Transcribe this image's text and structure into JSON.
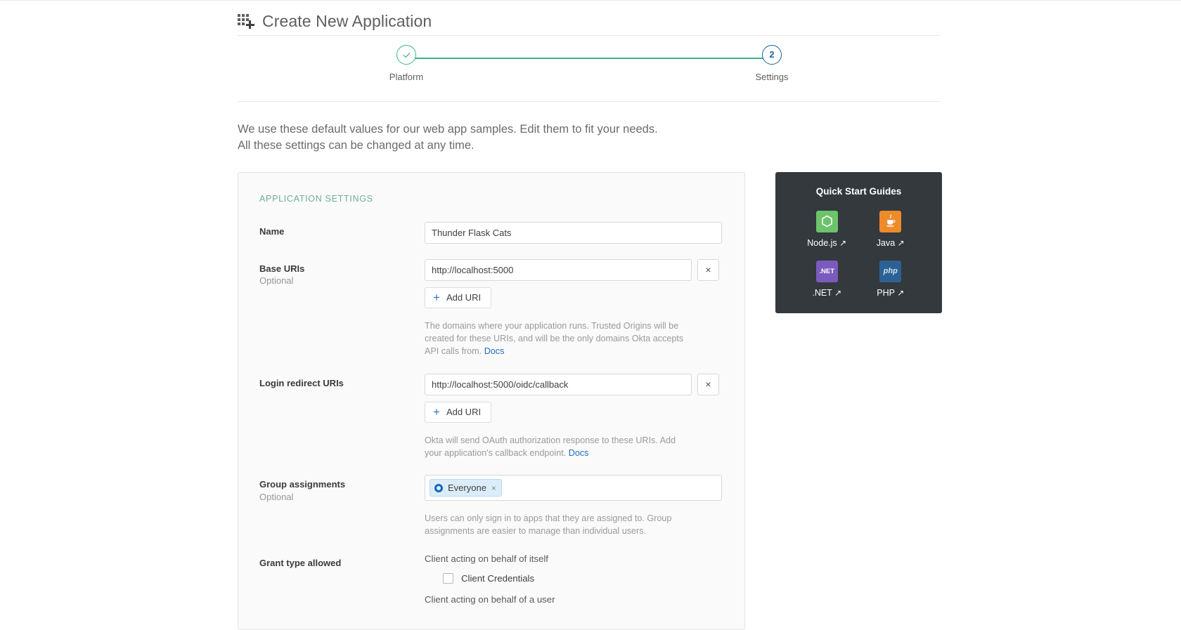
{
  "header": {
    "icon": "grid-plus-icon",
    "title": "Create New Application"
  },
  "stepper": {
    "step1": {
      "label": "Platform",
      "state": "completed",
      "icon": "check-icon"
    },
    "step2": {
      "label": "Settings",
      "number": "2",
      "state": "current"
    },
    "line_color": "#3db388",
    "current_color": "#1662a8"
  },
  "intro": {
    "line1": "We use these default values for our web app samples. Edit them to fit your needs.",
    "line2": "All these settings can be changed at any time."
  },
  "settings": {
    "section_title": "APPLICATION SETTINGS",
    "name": {
      "label": "Name",
      "value": "Thunder Flask Cats",
      "placeholder": ""
    },
    "base_uris": {
      "label": "Base URIs",
      "optional": "Optional",
      "value": "http://localhost:5000",
      "remove_label": "×",
      "add_label": "Add URI",
      "add_icon": "plus-icon",
      "help": "The domains where your application runs. Trusted Origins will be created for these URIs, and will be the only domains Okta accepts API calls from.",
      "docs_label": "Docs"
    },
    "login_redirect_uris": {
      "label": "Login redirect URIs",
      "value": "http://localhost:5000/oidc/callback",
      "remove_label": "×",
      "add_label": "Add URI",
      "add_icon": "plus-icon",
      "help": "Okta will send OAuth authorization response to these URIs. Add your application's callback endpoint.",
      "docs_label": "Docs"
    },
    "group_assignments": {
      "label": "Group assignments",
      "optional": "Optional",
      "chip_label": "Everyone",
      "chip_remove": "×",
      "help": "Users can only sign in to apps that they are assigned to. Group assignments are easier to manage than individual users."
    },
    "grant_type": {
      "label": "Grant type allowed",
      "group1_title": "Client acting on behalf of itself",
      "checkbox1_label": "Client Credentials",
      "checkbox1_checked": false,
      "group2_title": "Client acting on behalf of a user"
    }
  },
  "quickstart": {
    "title": "Quick Start Guides",
    "items": [
      {
        "label": "Node.js",
        "ext": "↗",
        "tile": "node",
        "tile_text": "",
        "color": "#6cc36c"
      },
      {
        "label": "Java",
        "ext": "↗",
        "tile": "java",
        "tile_text": "",
        "color": "#ed8b2b"
      },
      {
        "label": ".NET",
        "ext": "↗",
        "tile": "dotnet",
        "tile_text": ".NET",
        "color": "#7a5bbd"
      },
      {
        "label": "PHP",
        "ext": "↗",
        "tile": "php",
        "tile_text": "php",
        "color": "#2c6293"
      }
    ]
  }
}
